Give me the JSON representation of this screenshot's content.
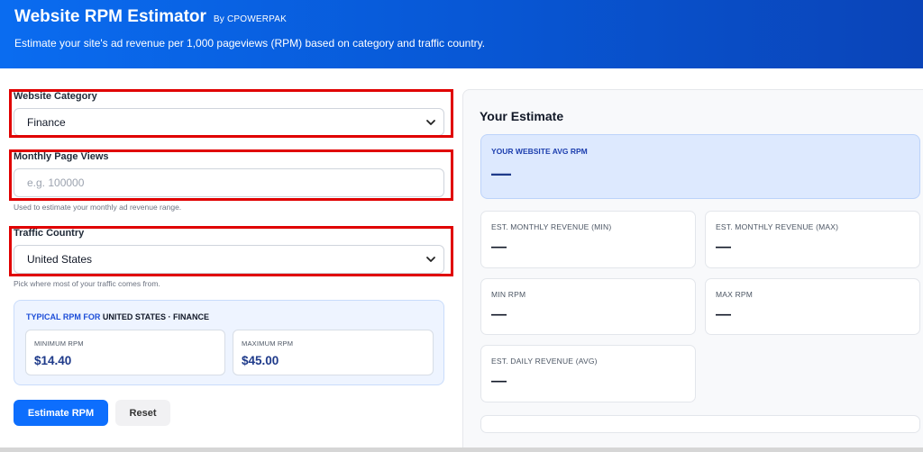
{
  "header": {
    "title": "Website RPM Estimator",
    "by": "By CPOWERPAK",
    "subtitle": "Estimate your site's ad revenue per 1,000 pageviews (RPM) based on category and traffic country."
  },
  "form": {
    "category": {
      "label": "Website Category",
      "value": "Finance"
    },
    "pageviews": {
      "label": "Monthly Page Views",
      "placeholder": "e.g. 100000",
      "help": "Used to estimate your monthly ad revenue range."
    },
    "country": {
      "label": "Traffic Country",
      "value": "United States",
      "help": "Pick where most of your traffic comes from."
    }
  },
  "typical": {
    "prefix": "TYPICAL RPM FOR ",
    "country": "UNITED STATES",
    "sep": " · ",
    "category": "FINANCE",
    "min": {
      "label": "MINIMUM RPM",
      "value": "$14.40"
    },
    "max": {
      "label": "MAXIMUM RPM",
      "value": "$45.00"
    }
  },
  "buttons": {
    "estimate": "Estimate RPM",
    "reset": "Reset"
  },
  "estimate": {
    "title": "Your Estimate",
    "avg": {
      "label": "YOUR WEBSITE AVG RPM",
      "value": "—"
    },
    "cards": {
      "rev_min": {
        "label": "EST. MONTHLY REVENUE (MIN)",
        "value": "—"
      },
      "rev_max": {
        "label": "EST. MONTHLY REVENUE (MAX)",
        "value": "—"
      },
      "min_rpm": {
        "label": "MIN RPM",
        "value": "—"
      },
      "max_rpm": {
        "label": "MAX RPM",
        "value": "—"
      },
      "daily": {
        "label": "EST. DAILY REVENUE (AVG)",
        "value": "—"
      }
    }
  },
  "colors": {
    "accent": "#0d6efd",
    "highlight_border": "#e00000"
  }
}
